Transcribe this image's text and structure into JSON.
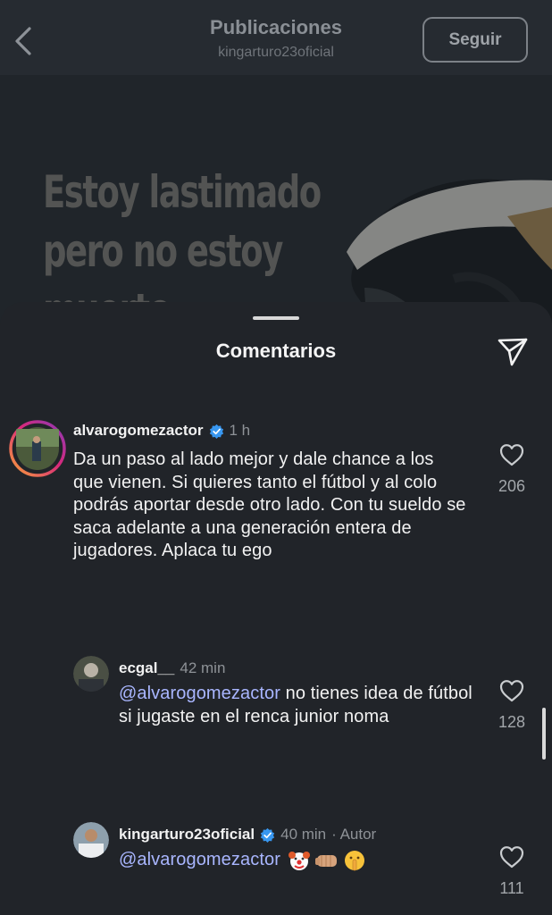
{
  "header": {
    "title": "Publicaciones",
    "subtitle": "kingarturo23oficial",
    "follow_label": "Seguir"
  },
  "post": {
    "quote_text": "Estoy lastimado\npero no estoy\nmuerto.\nMe recostaré"
  },
  "sheet": {
    "title": "Comentarios"
  },
  "comments": [
    {
      "username": "alvarogomezactor",
      "verified": true,
      "time": "1 h",
      "text": "Da un paso al lado mejor y dale chance a los que vienen. Si quieres tanto el fútbol y al colo podrás aportar desde otro lado. Con tu sueldo se saca adelante a una generación entera de jugadores. Aplaca tu ego",
      "likes": "206"
    },
    {
      "username": "ecgal__",
      "time": "42 min",
      "mention": "@alvarogomezactor",
      "text": " no tienes idea de fútbol si jugaste en el renca junior noma",
      "likes": "128"
    },
    {
      "username": "kingarturo23oficial",
      "verified": true,
      "time": "40 min",
      "author_label": "· Autor",
      "mention": "@alvarogomezactor",
      "emojis": [
        "clown-face",
        "fist",
        "shushing-face"
      ],
      "likes": "111"
    }
  ],
  "colors": {
    "sheet_bg": "#212429",
    "mention": "#a9b6ff",
    "verified": "#3897f0",
    "story_ring": [
      "#f9a23a",
      "#d8297a",
      "#8a3ab9"
    ]
  }
}
